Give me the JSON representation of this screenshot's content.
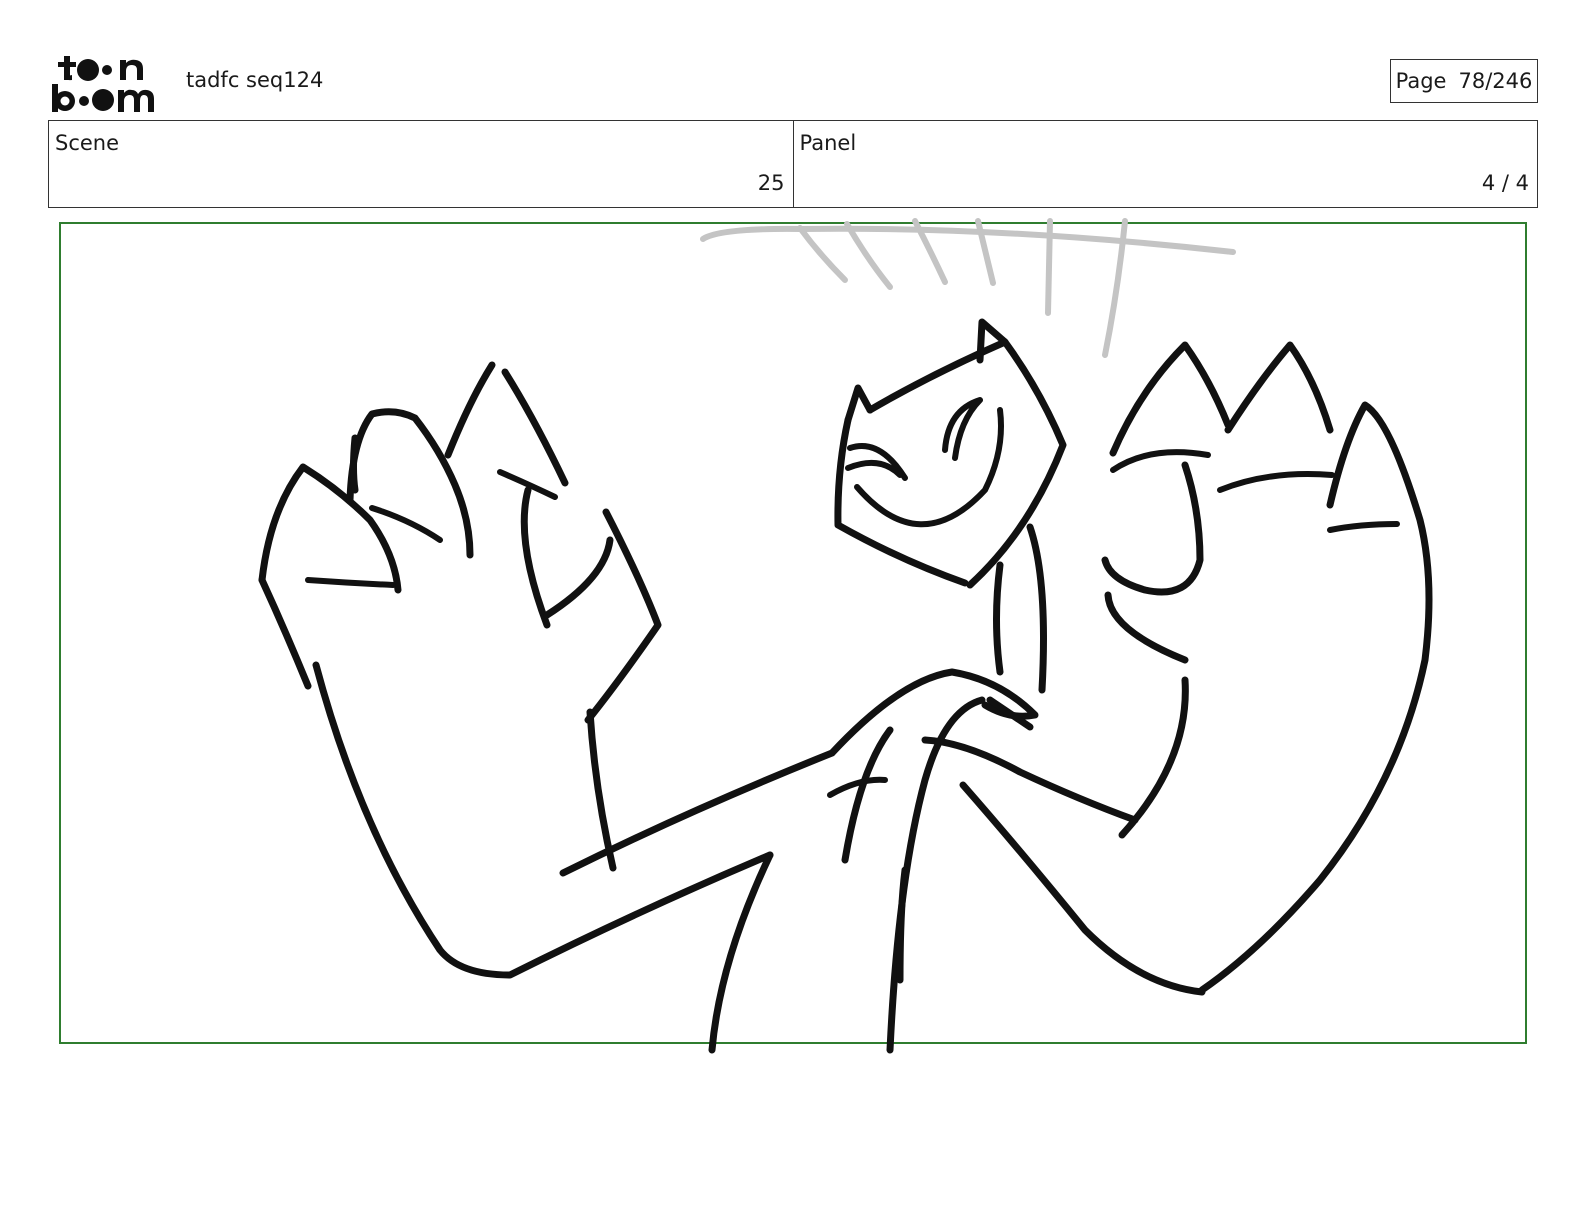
{
  "header": {
    "logo": {
      "text": "toon boom",
      "icon": "toon-boom-logo"
    },
    "project_name": "tadfc seq124",
    "page_label": "Page",
    "page_number": "78/246"
  },
  "info_table": {
    "scene": {
      "label": "Scene",
      "value": "25"
    },
    "panel": {
      "label": "Panel",
      "value": "4 / 4"
    }
  },
  "panel_frame": {
    "border_color": "#2f7d2f",
    "content": "storyboard-sketch"
  },
  "colors": {
    "ink": "#111111",
    "motion_lines": "#c4c4c4",
    "frame": "#2f7d2f"
  }
}
